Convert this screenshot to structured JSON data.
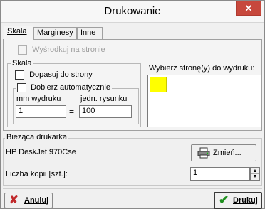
{
  "window": {
    "title": "Drukowanie",
    "close_glyph": "✕"
  },
  "tabs": [
    {
      "label": "Skala",
      "active": true
    },
    {
      "label": "Marginesy",
      "active": false
    },
    {
      "label": "Inne",
      "active": false
    }
  ],
  "skala_tab": {
    "center_checkbox_label": "Wyśrodkuj na stronie",
    "scale_group_title": "Skala",
    "fit_checkbox_label": "Dopasuj do strony",
    "auto_group_label": "Dobierz automatycznie",
    "mm_label": "mm wydruku",
    "mm_value": "1",
    "eq_sign": "=",
    "units_label": "jedn. rysunku",
    "units_value": "100",
    "pages_label": "Wybierz stronę(y) do wydruku:",
    "page_color": "#ffff00"
  },
  "printer": {
    "group_title": "Bieżąca drukarka",
    "name": "HP DeskJet 970Cse",
    "change_label": "Zmień...",
    "copies_label": "Liczba kopii [szt.]:",
    "copies_value": "1"
  },
  "footer": {
    "cancel_label": "Anuluj",
    "print_label": "Drukuj"
  },
  "colors": {
    "close_red": "#c7483c",
    "check_green": "#1e8f1e",
    "cancel_red": "#c0282a"
  }
}
